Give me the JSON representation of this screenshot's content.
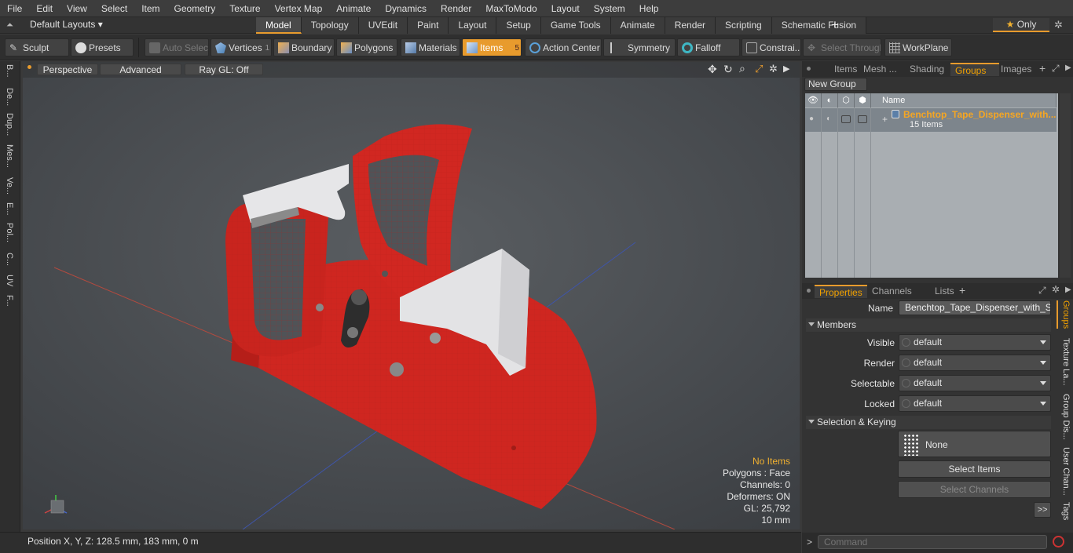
{
  "menu": [
    "File",
    "Edit",
    "View",
    "Select",
    "Item",
    "Geometry",
    "Texture",
    "Vertex Map",
    "Animate",
    "Dynamics",
    "Render",
    "MaxToModo",
    "Layout",
    "System",
    "Help"
  ],
  "layout_selector": "Default Layouts",
  "mode_tabs": [
    {
      "label": "Model",
      "active": true
    },
    {
      "label": "Topology"
    },
    {
      "label": "UVEdit"
    },
    {
      "label": "Paint"
    },
    {
      "label": "Layout"
    },
    {
      "label": "Setup"
    },
    {
      "label": "Game Tools"
    },
    {
      "label": "Animate"
    },
    {
      "label": "Render"
    },
    {
      "label": "Scripting"
    },
    {
      "label": "Schematic Fusion"
    }
  ],
  "only_label": "Only",
  "toolbar": {
    "sculpt": "Sculpt",
    "presets": "Presets",
    "auto_select": "Auto Select",
    "vertices": "Vertices",
    "vertices_count": "1",
    "boundary": "Boundary",
    "polygons": "Polygons",
    "materials": "Materials",
    "items": "Items",
    "items_count": "5",
    "action_center": "Action Center",
    "symmetry": "Symmetry",
    "falloff": "Falloff",
    "constraints": "Constrai...",
    "select_through": "Select Through",
    "workplane": "WorkPlane"
  },
  "left_tabs": [
    "B...",
    "De...",
    "Dup...",
    "Mes...",
    "Ve...",
    "E...",
    "Pol...",
    "C...",
    "UV",
    "F..."
  ],
  "viewport": {
    "view": "Perspective",
    "shading": "Advanced",
    "raygl": "Ray GL: Off",
    "info": {
      "no_items": "No Items",
      "polygons": "Polygons : Face",
      "channels": "Channels: 0",
      "deformers": "Deformers: ON",
      "gl": "GL: 25,792",
      "grid": "10 mm"
    }
  },
  "status": "Position X, Y, Z:   128.5 mm, 183 mm, 0 m",
  "top_panel": {
    "tabs": [
      "Items",
      "Mesh ...",
      "Shading",
      "Groups",
      "Images"
    ],
    "active_tab": "Groups",
    "new_group": "New Group",
    "name_col": "Name",
    "group_name": "Benchtop_Tape_Dispenser_with...",
    "group_count": "15 Items"
  },
  "properties": {
    "tabs": [
      "Properties",
      "Channels",
      "Lists"
    ],
    "name_label": "Name",
    "name_value": "Benchtop_Tape_Dispenser_with_Safe",
    "members": "Members",
    "visible_label": "Visible",
    "render_label": "Render",
    "selectable_label": "Selectable",
    "locked_label": "Locked",
    "default_value": "default",
    "sel_keying": "Selection & Keying",
    "none": "None",
    "select_items": "Select Items",
    "select_channels": "Select Channels",
    "more": ">>",
    "side_tabs": [
      "Groups",
      "Texture La...",
      "Group Dis...",
      "User Chan...",
      "Tags"
    ]
  },
  "command_placeholder": "Command",
  "colors": {
    "accent": "#e89b2d",
    "model_red": "#d42a22",
    "model_white": "#e8e8ea"
  }
}
